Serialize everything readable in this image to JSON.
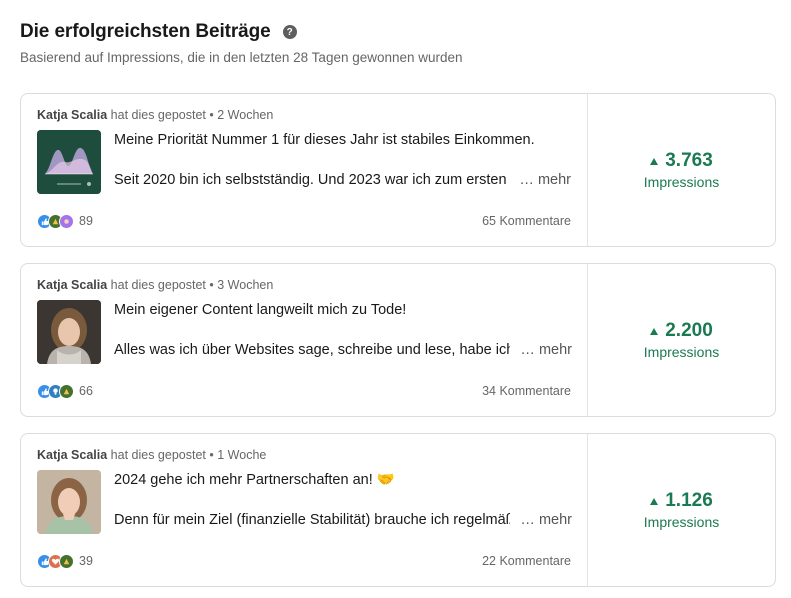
{
  "header": {
    "title": "Die erfolgreichsten Beiträge",
    "help_icon": "question-circle-icon",
    "subtitle": "Basierend auf Impressions, die in den letzten 28 Tagen gewonnen wurden"
  },
  "colors": {
    "accent_green": "#1b7a52",
    "like_blue": "#378fe9",
    "celebrate_green": "#44712e",
    "support_purple": "#a872e8",
    "love_red": "#df704d"
  },
  "posts": [
    {
      "author": "Katja Scalia",
      "posted_text": "hat dies gepostet",
      "separator": "•",
      "age": "2 Wochen",
      "line1": "Meine Priorität Nummer 1 für dieses Jahr ist stabiles Einkommen.",
      "line2": "Seit 2020 bin ich selbstständig. Und 2023 war ich zum ersten",
      "more": "… mehr",
      "reactions": [
        "like-icon",
        "celebrate-icon",
        "support-icon"
      ],
      "reaction_count": "89",
      "comments": "65 Kommentare",
      "impressions_value": "3.763",
      "impressions_label": "Impressions"
    },
    {
      "author": "Katja Scalia",
      "posted_text": "hat dies gepostet",
      "separator": "•",
      "age": "3 Wochen",
      "line1": "Mein eigener Content langweilt mich zu Tode!",
      "line2": "Alles was ich über Websites sage, schreibe und lese, habe ich",
      "more": "… mehr",
      "reactions": [
        "like-icon",
        "insightful-icon",
        "celebrate-icon"
      ],
      "reaction_count": "66",
      "comments": "34 Kommentare",
      "impressions_value": "2.200",
      "impressions_label": "Impressions"
    },
    {
      "author": "Katja Scalia",
      "posted_text": "hat dies gepostet",
      "separator": "•",
      "age": "1 Woche",
      "line1": "2024 gehe ich mehr Partnerschaften an! 🤝",
      "line2": "Denn für mein Ziel (finanzielle Stabilität) brauche ich regelmäß",
      "more": "… mehr",
      "reactions": [
        "like-icon",
        "love-icon",
        "celebrate-icon"
      ],
      "reaction_count": "39",
      "comments": "22 Kommentare",
      "impressions_value": "1.126",
      "impressions_label": "Impressions"
    }
  ]
}
